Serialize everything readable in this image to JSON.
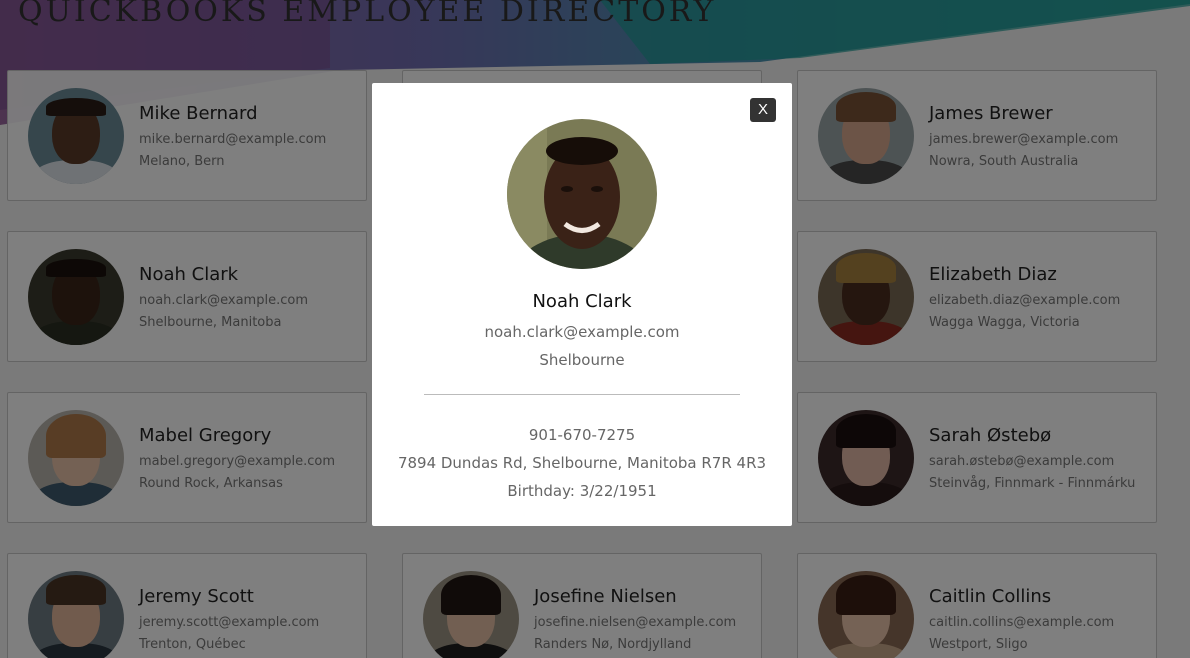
{
  "header": {
    "title": "QUICKBOOKS EMPLOYEE DIRECTORY"
  },
  "employees": [
    {
      "name": "Mike Bernard",
      "email": "mike.bernard@example.com",
      "location": "Melano, Bern"
    },
    {
      "name": "James Brewer",
      "email": "james.brewer@example.com",
      "location": "Nowra, South Australia"
    },
    {
      "name": "Noah Clark",
      "email": "noah.clark@example.com",
      "location": "Shelbourne, Manitoba"
    },
    {
      "name": "Elizabeth Diaz",
      "email": "elizabeth.diaz@example.com",
      "location": "Wagga Wagga, Victoria"
    },
    {
      "name": "Mabel Gregory",
      "email": "mabel.gregory@example.com",
      "location": "Round Rock, Arkansas"
    },
    {
      "name": "Sarah Østebø",
      "email": "sarah.østebø@example.com",
      "location": "Steinvåg, Finnmark - Finnmárku"
    },
    {
      "name": "Jeremy Scott",
      "email": "jeremy.scott@example.com",
      "location": "Trenton, Québec"
    },
    {
      "name": "Josefine Nielsen",
      "email": "josefine.nielsen@example.com",
      "location": "Randers Nø, Nordjylland"
    },
    {
      "name": "Caitlin Collins",
      "email": "caitlin.collins@example.com",
      "location": "Westport, Sligo"
    }
  ],
  "modal": {
    "close_label": "X",
    "name": "Noah Clark",
    "email": "noah.clark@example.com",
    "city": "Shelbourne",
    "phone": "901-670-7275",
    "address": "7894 Dundas Rd, Shelbourne, Manitoba R7R 4R3",
    "birthday": "Birthday: 3/22/1951"
  }
}
